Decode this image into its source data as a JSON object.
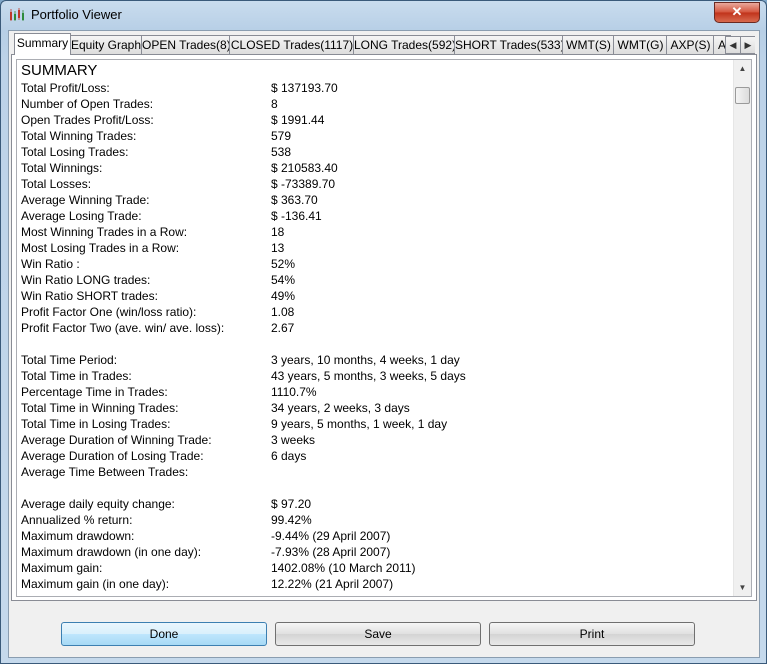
{
  "window": {
    "title": "Portfolio Viewer",
    "close_glyph": "✕"
  },
  "tabs": [
    "Summary",
    "Equity Graph",
    "OPEN Trades(8)",
    "CLOSED Trades(1117)",
    "LONG Trades(592)",
    "SHORT Trades(533)",
    "WMT(S)",
    "WMT(G)",
    "AXP(S)",
    "A"
  ],
  "active_tab": "Summary",
  "summary": {
    "heading": "SUMMARY",
    "section1": [
      [
        "Total Profit/Loss:",
        "$ 137193.70"
      ],
      [
        "Number of Open Trades:",
        "8"
      ],
      [
        "Open Trades Profit/Loss:",
        "$ 1991.44"
      ],
      [
        "Total Winning Trades:",
        "579"
      ],
      [
        "Total Losing Trades:",
        "538"
      ],
      [
        "Total Winnings:",
        "$ 210583.40"
      ],
      [
        "Total Losses:",
        "$ -73389.70"
      ],
      [
        "Average Winning Trade:",
        "$ 363.70"
      ],
      [
        "Average Losing Trade:",
        "$ -136.41"
      ],
      [
        "Most Winning Trades in a Row:",
        "18"
      ],
      [
        "Most Losing Trades in a Row:",
        "13"
      ],
      [
        "Win Ratio :",
        "52%"
      ],
      [
        "Win Ratio LONG trades:",
        "54%"
      ],
      [
        "Win Ratio SHORT trades:",
        "49%"
      ],
      [
        "Profit Factor One (win/loss ratio):",
        "1.08"
      ],
      [
        "Profit Factor Two (ave. win/ ave. loss):",
        "2.67"
      ]
    ],
    "section2": [
      [
        "Total Time Period:",
        "3 years, 10 months, 4 weeks, 1 day"
      ],
      [
        "Total Time in Trades:",
        "43 years, 5 months, 3 weeks, 5 days"
      ],
      [
        "Percentage Time in Trades:",
        "1110.7%"
      ],
      [
        "Total Time in Winning Trades:",
        "34 years, 2 weeks, 3 days"
      ],
      [
        "Total Time in Losing Trades:",
        "9 years, 5 months, 1 week, 1 day"
      ],
      [
        "Average Duration of Winning Trade:",
        "3 weeks"
      ],
      [
        "Average Duration of Losing Trade:",
        "6 days"
      ],
      [
        "Average Time Between Trades:",
        ""
      ]
    ],
    "section3": [
      [
        "Average daily equity change:",
        "$ 97.20"
      ],
      [
        "Annualized % return:",
        "99.42%"
      ],
      [
        "Maximum drawdown:",
        "-9.44% (29 April 2007)"
      ],
      [
        "Maximum drawdown (in one day):",
        "-7.93% (28 April 2007)"
      ],
      [
        "Maximum gain:",
        "1402.08% (10 March 2011)"
      ],
      [
        "Maximum gain (in one day):",
        "12.22% (21 April 2007)"
      ]
    ]
  },
  "buttons": {
    "done": "Done",
    "save": "Save",
    "print": "Print"
  },
  "icons": {
    "app": "candlestick-chart-icon",
    "tab_left": "chevron-left-icon",
    "tab_right": "chevron-right-icon",
    "scroll_up": "scroll-up-arrow-icon",
    "scroll_down": "scroll-down-arrow-icon"
  }
}
